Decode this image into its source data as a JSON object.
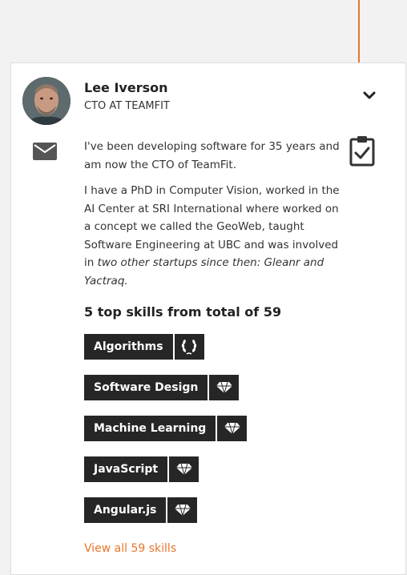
{
  "profile": {
    "name": "Lee Iverson",
    "role": "CTO AT TEAMFIT"
  },
  "bio": {
    "p1": "I've been developing software for 35 years and am now the CTO of TeamFit.",
    "p2_plain": "I have a PhD in Computer Vision, worked in the AI Center at SRI International where worked on a concept we called the GeoWeb, taught Software Engineering at UBC and was involved in ",
    "p2_italic": "two other startups since then: Gleanr and Yactraq."
  },
  "skills_summary": "5 top skills from total of 59",
  "skills": [
    {
      "label": "Algorithms",
      "badge_icon": "laurel-wreath-icon"
    },
    {
      "label": "Software Design",
      "badge_icon": "diamond-icon"
    },
    {
      "label": "Machine Learning",
      "badge_icon": "diamond-icon"
    },
    {
      "label": "JavaScript",
      "badge_icon": "diamond-icon"
    },
    {
      "label": "Angular.js",
      "badge_icon": "diamond-icon"
    }
  ],
  "view_all": "View all 59 skills",
  "colors": {
    "accent": "#e8762d",
    "chip_bg": "#262626",
    "icon_gray": "#555555"
  }
}
